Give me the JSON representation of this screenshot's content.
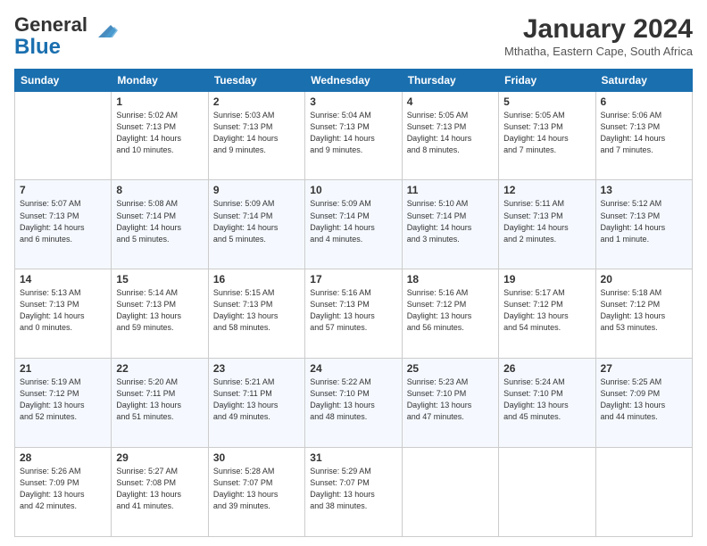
{
  "header": {
    "logo_general": "General",
    "logo_blue": "Blue",
    "month_title": "January 2024",
    "location": "Mthatha, Eastern Cape, South Africa"
  },
  "days_of_week": [
    "Sunday",
    "Monday",
    "Tuesday",
    "Wednesday",
    "Thursday",
    "Friday",
    "Saturday"
  ],
  "weeks": [
    [
      {
        "day": "",
        "info": ""
      },
      {
        "day": "1",
        "info": "Sunrise: 5:02 AM\nSunset: 7:13 PM\nDaylight: 14 hours\nand 10 minutes."
      },
      {
        "day": "2",
        "info": "Sunrise: 5:03 AM\nSunset: 7:13 PM\nDaylight: 14 hours\nand 9 minutes."
      },
      {
        "day": "3",
        "info": "Sunrise: 5:04 AM\nSunset: 7:13 PM\nDaylight: 14 hours\nand 9 minutes."
      },
      {
        "day": "4",
        "info": "Sunrise: 5:05 AM\nSunset: 7:13 PM\nDaylight: 14 hours\nand 8 minutes."
      },
      {
        "day": "5",
        "info": "Sunrise: 5:05 AM\nSunset: 7:13 PM\nDaylight: 14 hours\nand 7 minutes."
      },
      {
        "day": "6",
        "info": "Sunrise: 5:06 AM\nSunset: 7:13 PM\nDaylight: 14 hours\nand 7 minutes."
      }
    ],
    [
      {
        "day": "7",
        "info": "Sunrise: 5:07 AM\nSunset: 7:13 PM\nDaylight: 14 hours\nand 6 minutes."
      },
      {
        "day": "8",
        "info": "Sunrise: 5:08 AM\nSunset: 7:14 PM\nDaylight: 14 hours\nand 5 minutes."
      },
      {
        "day": "9",
        "info": "Sunrise: 5:09 AM\nSunset: 7:14 PM\nDaylight: 14 hours\nand 5 minutes."
      },
      {
        "day": "10",
        "info": "Sunrise: 5:09 AM\nSunset: 7:14 PM\nDaylight: 14 hours\nand 4 minutes."
      },
      {
        "day": "11",
        "info": "Sunrise: 5:10 AM\nSunset: 7:14 PM\nDaylight: 14 hours\nand 3 minutes."
      },
      {
        "day": "12",
        "info": "Sunrise: 5:11 AM\nSunset: 7:13 PM\nDaylight: 14 hours\nand 2 minutes."
      },
      {
        "day": "13",
        "info": "Sunrise: 5:12 AM\nSunset: 7:13 PM\nDaylight: 14 hours\nand 1 minute."
      }
    ],
    [
      {
        "day": "14",
        "info": "Sunrise: 5:13 AM\nSunset: 7:13 PM\nDaylight: 14 hours\nand 0 minutes."
      },
      {
        "day": "15",
        "info": "Sunrise: 5:14 AM\nSunset: 7:13 PM\nDaylight: 13 hours\nand 59 minutes."
      },
      {
        "day": "16",
        "info": "Sunrise: 5:15 AM\nSunset: 7:13 PM\nDaylight: 13 hours\nand 58 minutes."
      },
      {
        "day": "17",
        "info": "Sunrise: 5:16 AM\nSunset: 7:13 PM\nDaylight: 13 hours\nand 57 minutes."
      },
      {
        "day": "18",
        "info": "Sunrise: 5:16 AM\nSunset: 7:12 PM\nDaylight: 13 hours\nand 56 minutes."
      },
      {
        "day": "19",
        "info": "Sunrise: 5:17 AM\nSunset: 7:12 PM\nDaylight: 13 hours\nand 54 minutes."
      },
      {
        "day": "20",
        "info": "Sunrise: 5:18 AM\nSunset: 7:12 PM\nDaylight: 13 hours\nand 53 minutes."
      }
    ],
    [
      {
        "day": "21",
        "info": "Sunrise: 5:19 AM\nSunset: 7:12 PM\nDaylight: 13 hours\nand 52 minutes."
      },
      {
        "day": "22",
        "info": "Sunrise: 5:20 AM\nSunset: 7:11 PM\nDaylight: 13 hours\nand 51 minutes."
      },
      {
        "day": "23",
        "info": "Sunrise: 5:21 AM\nSunset: 7:11 PM\nDaylight: 13 hours\nand 49 minutes."
      },
      {
        "day": "24",
        "info": "Sunrise: 5:22 AM\nSunset: 7:10 PM\nDaylight: 13 hours\nand 48 minutes."
      },
      {
        "day": "25",
        "info": "Sunrise: 5:23 AM\nSunset: 7:10 PM\nDaylight: 13 hours\nand 47 minutes."
      },
      {
        "day": "26",
        "info": "Sunrise: 5:24 AM\nSunset: 7:10 PM\nDaylight: 13 hours\nand 45 minutes."
      },
      {
        "day": "27",
        "info": "Sunrise: 5:25 AM\nSunset: 7:09 PM\nDaylight: 13 hours\nand 44 minutes."
      }
    ],
    [
      {
        "day": "28",
        "info": "Sunrise: 5:26 AM\nSunset: 7:09 PM\nDaylight: 13 hours\nand 42 minutes."
      },
      {
        "day": "29",
        "info": "Sunrise: 5:27 AM\nSunset: 7:08 PM\nDaylight: 13 hours\nand 41 minutes."
      },
      {
        "day": "30",
        "info": "Sunrise: 5:28 AM\nSunset: 7:07 PM\nDaylight: 13 hours\nand 39 minutes."
      },
      {
        "day": "31",
        "info": "Sunrise: 5:29 AM\nSunset: 7:07 PM\nDaylight: 13 hours\nand 38 minutes."
      },
      {
        "day": "",
        "info": ""
      },
      {
        "day": "",
        "info": ""
      },
      {
        "day": "",
        "info": ""
      }
    ]
  ]
}
